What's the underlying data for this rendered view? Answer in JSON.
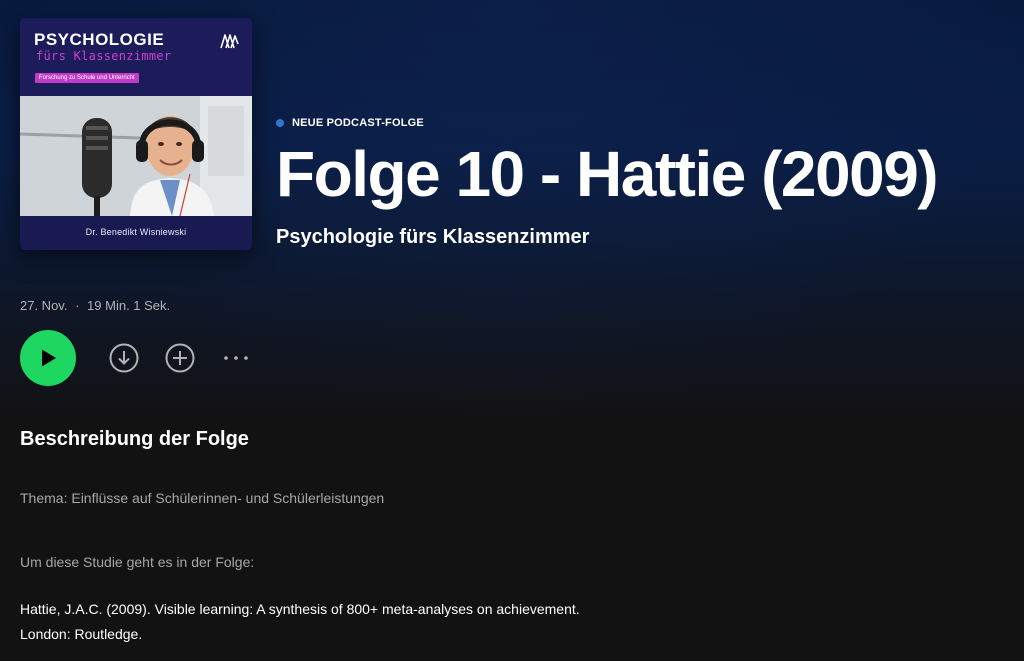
{
  "cover": {
    "title": "PSYCHOLOGIE",
    "subtitle": "fürs Klassenzimmer",
    "tag": "Forschung zu Schule und Unterricht",
    "author": "Dr. Benedikt Wisniewski",
    "logo_icon": "anchor-logo-icon"
  },
  "header": {
    "badge": "NEUE PODCAST-FOLGE",
    "badge_color": "#2e77d0",
    "title": "Folge 10 - Hattie (2009)",
    "show": "Psychologie fürs Klassenzimmer"
  },
  "meta": {
    "date": "27. Nov.",
    "separator": "·",
    "duration": "19 Min. 1 Sek."
  },
  "actions": {
    "play_icon": "play-icon",
    "download_icon": "download-icon",
    "add_icon": "add-icon",
    "more_icon": "more-icon",
    "accent": "#1ed760"
  },
  "description": {
    "heading": "Beschreibung der Folge",
    "topic": "Thema: Einflüsse auf Schülerinnen- und Schülerleistungen",
    "intro": "Um diese Studie geht es in der Folge:",
    "reference_line1": "Hattie, J.A.C. (2009). Visible learning: A synthesis of 800+ meta-analyses on achievement.",
    "reference_line2": "London: Routledge."
  }
}
